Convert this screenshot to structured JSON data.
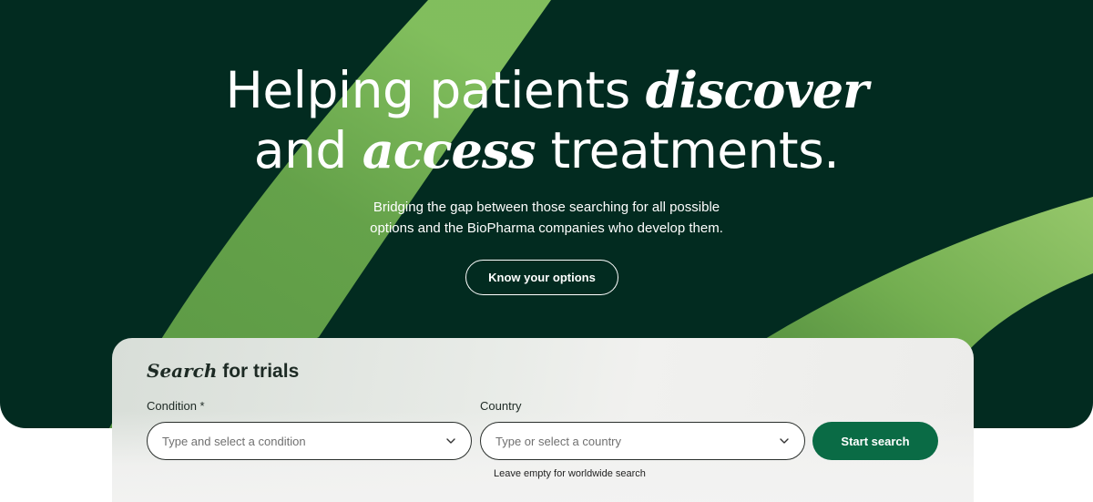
{
  "hero": {
    "headline_line1_pre": "Helping patients ",
    "headline_line1_em": "discover",
    "headline_line2_pre": "and ",
    "headline_line2_em": "access",
    "headline_line2_post": " treatments.",
    "subtext_line1": "Bridging the gap between those searching for all possible",
    "subtext_line2": "options and the BioPharma companies who develop them.",
    "cta_label": "Know your options"
  },
  "search": {
    "title_em": "Search",
    "title_rest": " for trials",
    "condition": {
      "label": "Condition *",
      "placeholder": "Type and select a condition",
      "value": ""
    },
    "country": {
      "label": "Country",
      "placeholder": "Type or select a country",
      "value": "",
      "hint": "Leave empty for worldwide search"
    },
    "submit_label": "Start search"
  },
  "colors": {
    "hero_bg": "#022b20",
    "swoosh": "#7fbb55",
    "accent": "#0a6b45"
  },
  "icons": {
    "dropdown": "chevron-down-icon"
  }
}
